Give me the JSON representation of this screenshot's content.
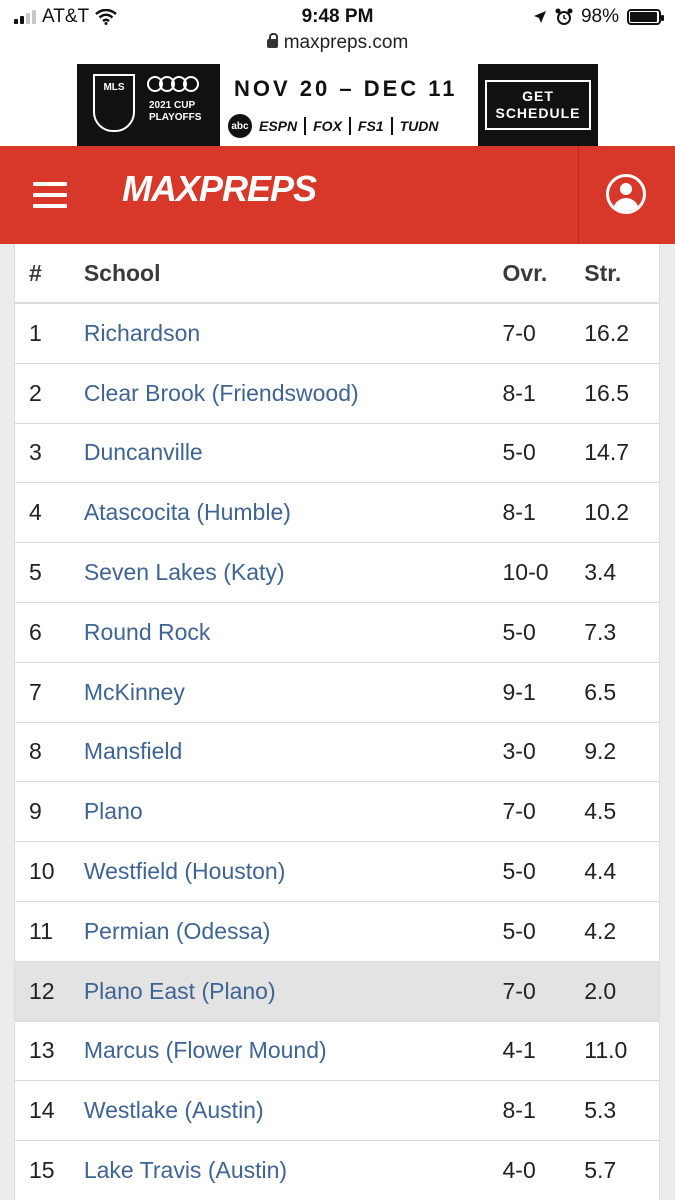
{
  "status_bar": {
    "carrier": "AT&T",
    "time": "9:48 PM",
    "battery": "98%",
    "battery_level": 0.98
  },
  "url_bar": {
    "url": "maxpreps.com"
  },
  "ad": {
    "mls_text": "MLS",
    "cup_line1": "2021 CUP",
    "cup_line2": "PLAYOFFS",
    "dates": "NOV 20 – DEC 11",
    "networks": [
      "abc",
      "ESPN",
      "FOX",
      "FS1",
      "TUDN"
    ],
    "cta_line1": "GET",
    "cta_line2": "SCHEDULE"
  },
  "header": {
    "logo_text": "MAXPREPS"
  },
  "table": {
    "columns": {
      "rank": "#",
      "school": "School",
      "overall": "Ovr.",
      "strength": "Str."
    },
    "rows": [
      {
        "rank": "1",
        "school": "Richardson",
        "overall": "7-0",
        "strength": "16.2"
      },
      {
        "rank": "2",
        "school": "Clear Brook (Friendswood)",
        "overall": "8-1",
        "strength": "16.5"
      },
      {
        "rank": "3",
        "school": "Duncanville",
        "overall": "5-0",
        "strength": "14.7"
      },
      {
        "rank": "4",
        "school": "Atascocita (Humble)",
        "overall": "8-1",
        "strength": "10.2"
      },
      {
        "rank": "5",
        "school": "Seven Lakes (Katy)",
        "overall": "10-0",
        "strength": "3.4"
      },
      {
        "rank": "6",
        "school": "Round Rock",
        "overall": "5-0",
        "strength": "7.3"
      },
      {
        "rank": "7",
        "school": "McKinney",
        "overall": "9-1",
        "strength": "6.5"
      },
      {
        "rank": "8",
        "school": "Mansfield",
        "overall": "3-0",
        "strength": "9.2"
      },
      {
        "rank": "9",
        "school": "Plano",
        "overall": "7-0",
        "strength": "4.5"
      },
      {
        "rank": "10",
        "school": "Westfield (Houston)",
        "overall": "5-0",
        "strength": "4.4"
      },
      {
        "rank": "11",
        "school": "Permian (Odessa)",
        "overall": "5-0",
        "strength": "4.2"
      },
      {
        "rank": "12",
        "school": "Plano East (Plano)",
        "overall": "7-0",
        "strength": "2.0"
      },
      {
        "rank": "13",
        "school": "Marcus (Flower Mound)",
        "overall": "4-1",
        "strength": "11.0"
      },
      {
        "rank": "14",
        "school": "Westlake (Austin)",
        "overall": "8-1",
        "strength": "5.3"
      },
      {
        "rank": "15",
        "school": "Lake Travis (Austin)",
        "overall": "4-0",
        "strength": "5.7"
      }
    ]
  },
  "colors": {
    "brand_red": "#d7382a",
    "link_blue": "#3f6494",
    "highlight_row": "#e3e3e3"
  }
}
